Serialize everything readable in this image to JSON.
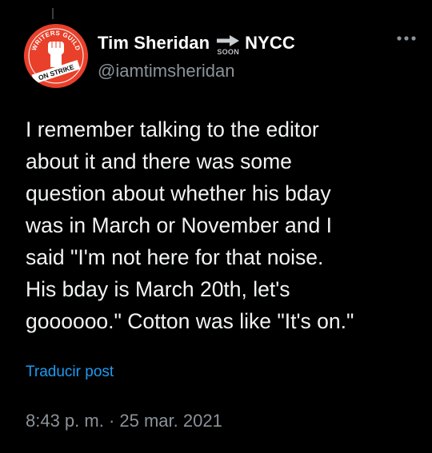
{
  "author": {
    "display_name": "Tim Sheridan",
    "soon_label": "SOON",
    "display_name_suffix": "NYCC",
    "handle": "@iamtimsheridan",
    "avatar_text_top": "WRITERS GUILD",
    "avatar_text_bottom": "ON STRIKE"
  },
  "post": {
    "text": "I remember talking to the editor\nabout it and there was some\nquestion about whether his bday\nwas in March or November and I\nsaid \"I'm not here for that noise.\nHis bday is March 20th, let's\ngoooooo.\" Cotton was like \"It's on.\"",
    "translate_label": "Traducir post",
    "timestamp": "8:43 p. m. · 25 mar. 2021"
  },
  "icons": {
    "more": "more-horizontal-icon",
    "arrow": "arrow-right-icon",
    "fist": "raised-fist-icon"
  },
  "colors": {
    "background": "#000000",
    "text": "#f1f3f4",
    "muted": "#8b9299",
    "link": "#1d9bf0",
    "avatar_red": "#e8402a"
  }
}
